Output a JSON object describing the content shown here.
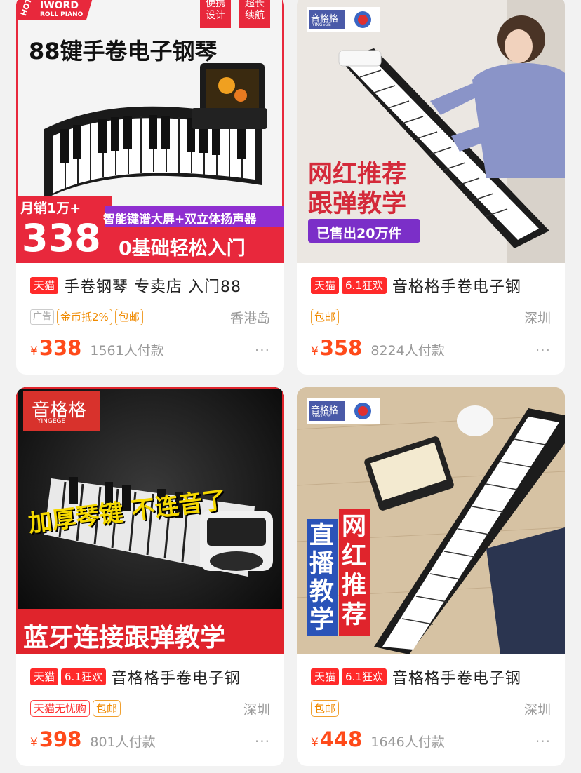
{
  "products": [
    {
      "image": {
        "brand_hot": "HOT",
        "brand_name": "IWORD",
        "brand_sub": "ROLL PIANO",
        "tag_portable": "便携\n设计",
        "tag_battery": "超长\n续航",
        "headline": "88键手卷电子钢琴",
        "monthly_sales": "月销1万+",
        "big_price": "338",
        "feature": "智能键谱大屏+双立体扬声器",
        "slogan": "0基础轻松入门"
      },
      "tags_title": [
        "天猫"
      ],
      "title": "手卷钢琴 专卖店 入门88",
      "ad_label": "广告",
      "tags": [
        {
          "text": "金币抵2%",
          "style": "orange"
        },
        {
          "text": "包邮",
          "style": "orange"
        }
      ],
      "location": "香港岛",
      "currency": "¥",
      "price": "338",
      "paid": "1561人付款",
      "more": "···"
    },
    {
      "image": {
        "brand": "音格格",
        "brand_sub": "YINGEGE",
        "line1": "网红推荐",
        "line2": "跟弹教学",
        "sold": "已售出20万件"
      },
      "tags_title": [
        "天猫",
        "6.1狂欢"
      ],
      "title": "音格格手卷电子钢",
      "tags": [
        {
          "text": "包邮",
          "style": "orange"
        }
      ],
      "location": "深圳",
      "currency": "¥",
      "price": "358",
      "paid": "8224人付款",
      "more": "···"
    },
    {
      "image": {
        "brand": "音格格",
        "brand_sub": "YINGEGE",
        "headline": "加厚琴键 不连音了",
        "banner": "蓝牙连接跟弹教学"
      },
      "tags_title": [
        "天猫",
        "6.1狂欢"
      ],
      "title": "音格格手卷电子钢",
      "tags": [
        {
          "text": "天猫无忧购",
          "style": "red"
        },
        {
          "text": "包邮",
          "style": "orange"
        }
      ],
      "location": "深圳",
      "currency": "¥",
      "price": "398",
      "paid": "801人付款",
      "more": "···"
    },
    {
      "image": {
        "brand": "音格格",
        "brand_sub": "YINGEGE",
        "col1": "直播教学",
        "col2": "网红推荐"
      },
      "tags_title": [
        "天猫",
        "6.1狂欢"
      ],
      "title": "音格格手卷电子钢",
      "tags": [
        {
          "text": "包邮",
          "style": "orange"
        }
      ],
      "location": "深圳",
      "currency": "¥",
      "price": "448",
      "paid": "1646人付款",
      "more": "···"
    }
  ]
}
